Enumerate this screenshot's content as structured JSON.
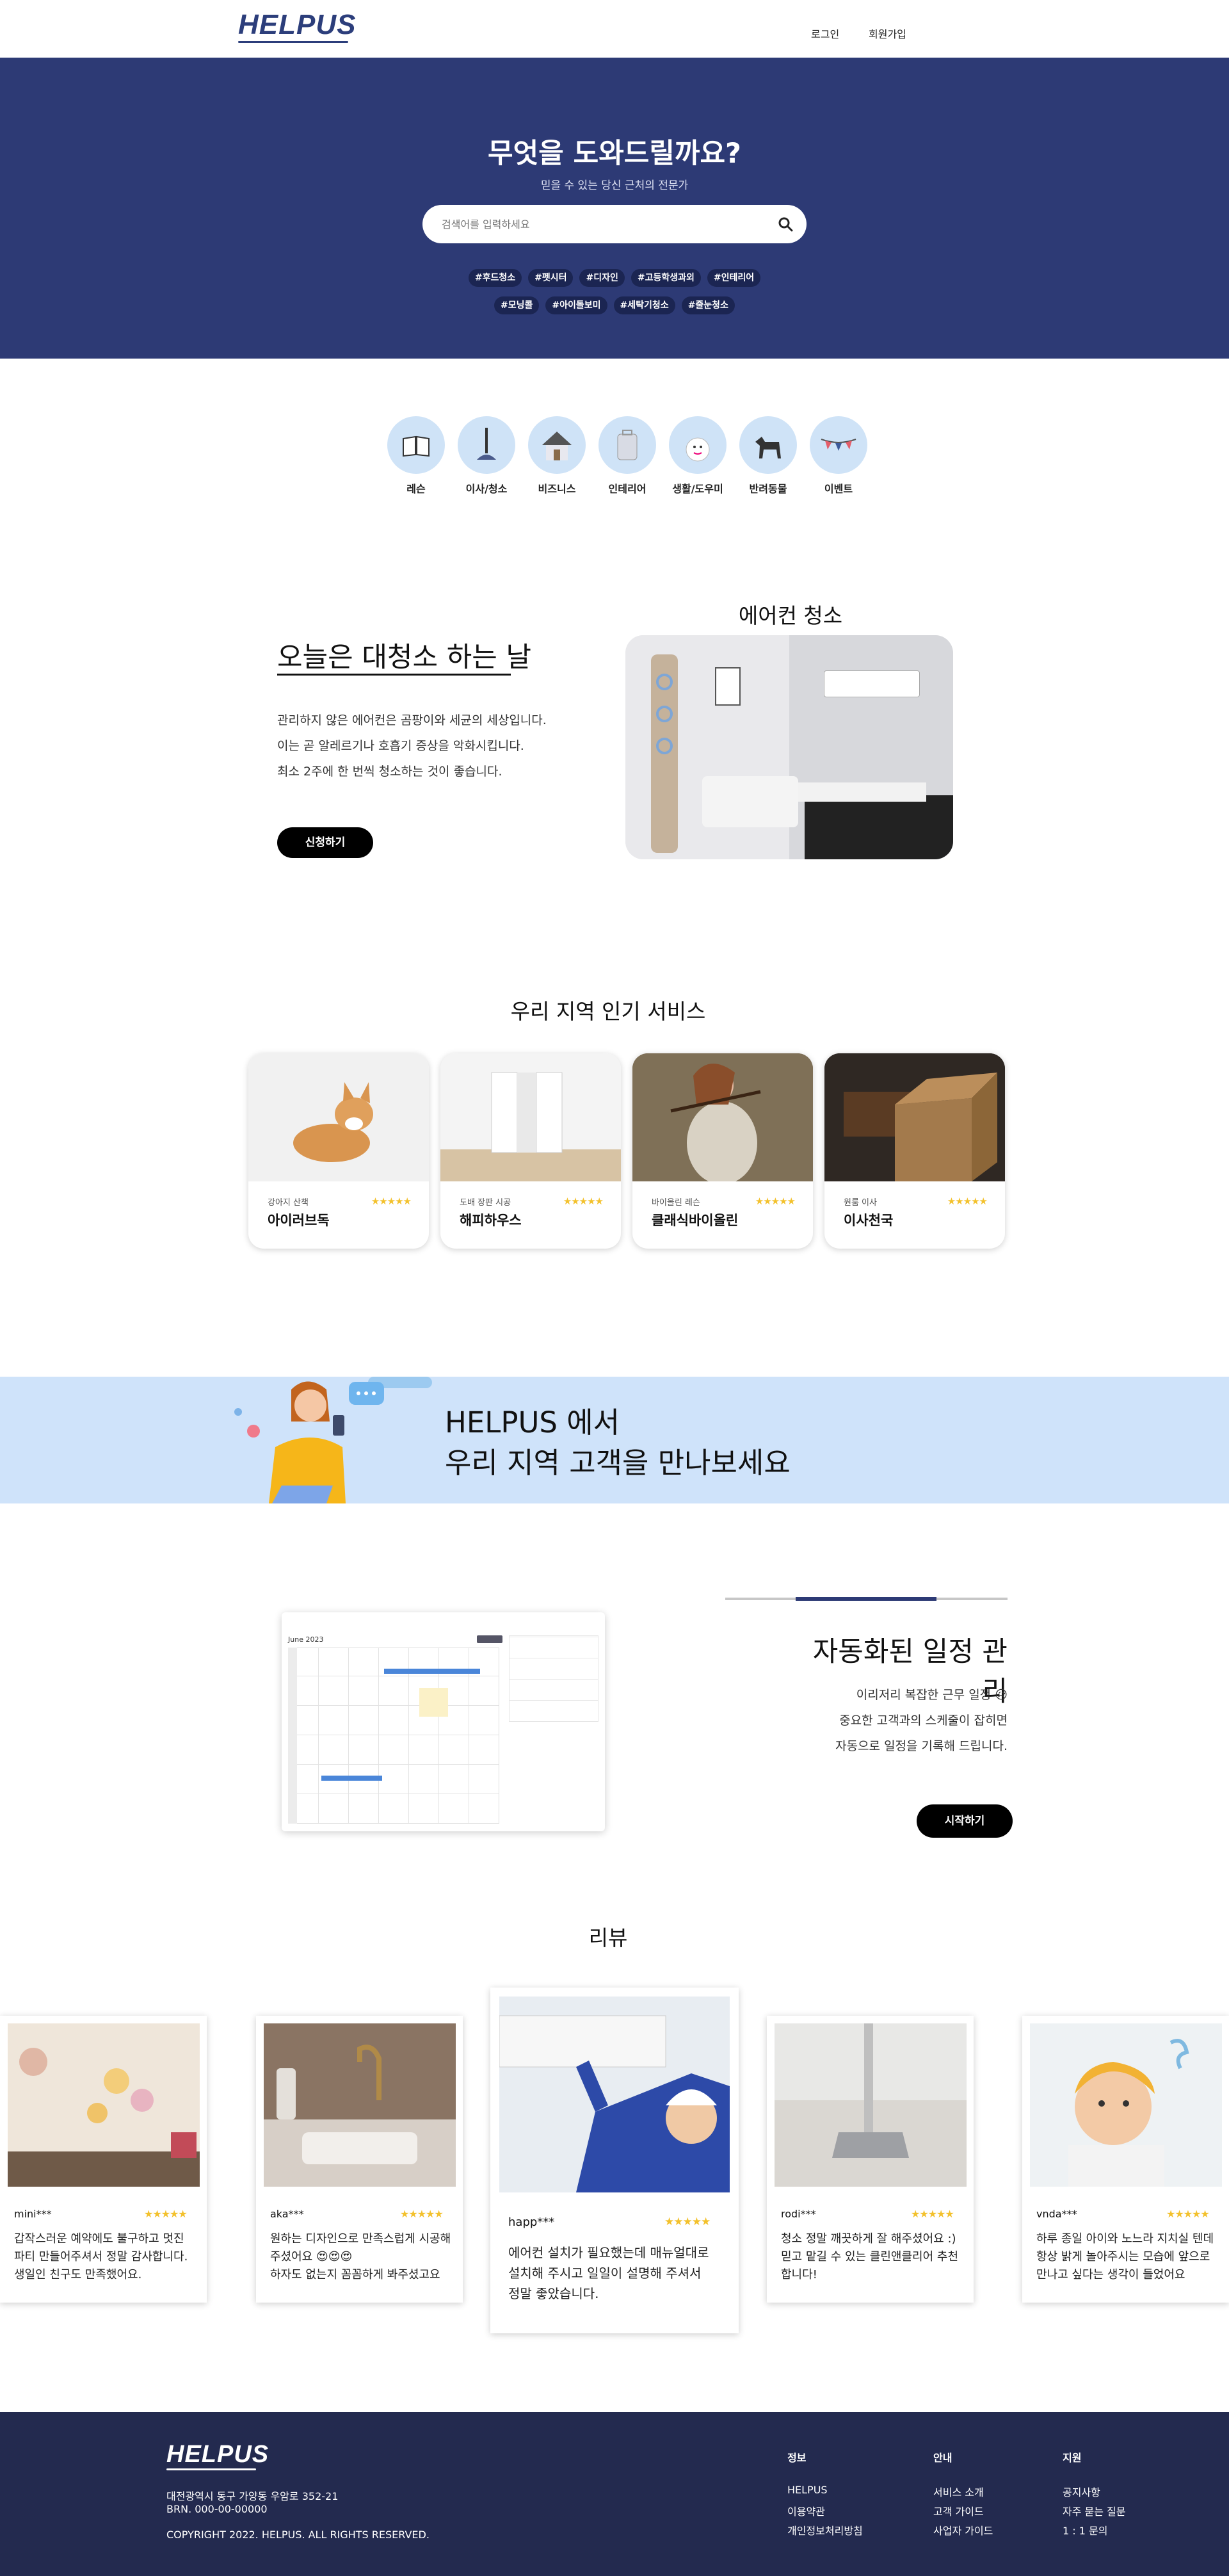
{
  "header": {
    "logo": "HELPUS",
    "login": "로그인",
    "signup": "회원가입"
  },
  "hero": {
    "title": "무엇을 도와드릴까요?",
    "subtitle": "믿을 수 있는 당신 근처의 전문가",
    "search_placeholder": "검색어를 입력하세요",
    "tags_row1": [
      "#후드청소",
      "#펫시터",
      "#디자인",
      "#고등학생과외",
      "#인테리어"
    ],
    "tags_row2": [
      "#모닝콜",
      "#아이돌보미",
      "#세탁기청소",
      "#줄눈청소"
    ]
  },
  "categories": [
    {
      "label": "레슨",
      "icon": "book-icon"
    },
    {
      "label": "이사/청소",
      "icon": "plunger-icon"
    },
    {
      "label": "비즈니스",
      "icon": "house-icon"
    },
    {
      "label": "인테리어",
      "icon": "luggage-icon"
    },
    {
      "label": "생활/도우미",
      "icon": "snowman-icon"
    },
    {
      "label": "반려동물",
      "icon": "dog-icon"
    },
    {
      "label": "이벤트",
      "icon": "bunting-icon"
    }
  ],
  "promo": {
    "title": "오늘은 대청소 하는 날",
    "lines": [
      "관리하지 않은 에어컨은 곰팡이와 세균의 세상입니다.",
      "이는 곧 알레르기나 호흡기 증상을 악화시킵니다.",
      "최소 2주에 한 번씩 청소하는 것이 좋습니다."
    ],
    "button": "신청하기",
    "image_caption": "에어컨 청소"
  },
  "popular": {
    "title": "우리 지역 인기 서비스",
    "cards": [
      {
        "small": "강아지 산책",
        "name": "아이러브독",
        "stars": "★★★★★"
      },
      {
        "small": "도배 장판 시공",
        "name": "해피하우스",
        "stars": "★★★★★"
      },
      {
        "small": "바이올린 레슨",
        "name": "클래식바이올린",
        "stars": "★★★★★"
      },
      {
        "small": "원룸 이사",
        "name": "이사천국",
        "stars": "★★★★★"
      }
    ]
  },
  "banner": {
    "line1": "HELPUS 에서",
    "line2": "우리 지역 고객을 만나보세요"
  },
  "schedule": {
    "title": "자동화된 일정 관리",
    "lines": [
      "이리저리 복잡한 근무 일정 😥",
      "중요한 고객과의 스케줄이 잡히면",
      "자동으로 일정을 기록해 드립니다."
    ],
    "button": "시작하기",
    "calendar_month": "June 2023"
  },
  "reviews": {
    "title": "리뷰",
    "items": [
      {
        "user": "mini***",
        "stars": "★★★★★",
        "lines": [
          "갑작스러운 예약에도 불구하고 멋진",
          "파티 만들어주셔서 정말 감사합니다.",
          "생일인 친구도 만족했어요."
        ]
      },
      {
        "user": "aka***",
        "stars": "★★★★★",
        "lines": [
          "원하는 디자인으로 만족스럽게 시공해",
          "주셨어요 😍😍😍",
          "하자도 없는지 꼼꼼하게 봐주셨고요"
        ]
      },
      {
        "user": "happ***",
        "stars": "★★★★★",
        "lines": [
          "에어컨 설치가 필요했는데 매뉴얼대로",
          "설치해 주시고 일일이 설명해 주셔서",
          "정말 좋았습니다."
        ]
      },
      {
        "user": "rodi***",
        "stars": "★★★★★",
        "lines": [
          "청소 정말 깨끗하게 잘 해주셨어요 :)",
          "믿고 맡길 수 있는 클린앤클리어 추천",
          "합니다!"
        ]
      },
      {
        "user": "vnda***",
        "stars": "★★★★★",
        "lines": [
          "하루 종일 아이와 노느라 지치실 텐데",
          "항상 밝게 놀아주시는 모습에 앞으로",
          "만나고 싶다는 생각이 들었어요"
        ]
      }
    ]
  },
  "footer": {
    "logo": "HELPUS",
    "address": "대전광역시 동구 가양동 우암로 352-21",
    "brn": "BRN. 000-00-00000",
    "copyright": "COPYRIGHT 2022. HELPUS. ALL RIGHTS RESERVED.",
    "cols": [
      {
        "title": "정보",
        "items": [
          "HELPUS",
          "이용약관",
          "개인정보처리방침"
        ]
      },
      {
        "title": "안내",
        "items": [
          "서비스 소개",
          "고객 가이드",
          "사업자 가이드"
        ]
      },
      {
        "title": "지원",
        "items": [
          "공지사항",
          "자주 묻는 질문",
          "1 : 1 문의"
        ]
      }
    ]
  }
}
